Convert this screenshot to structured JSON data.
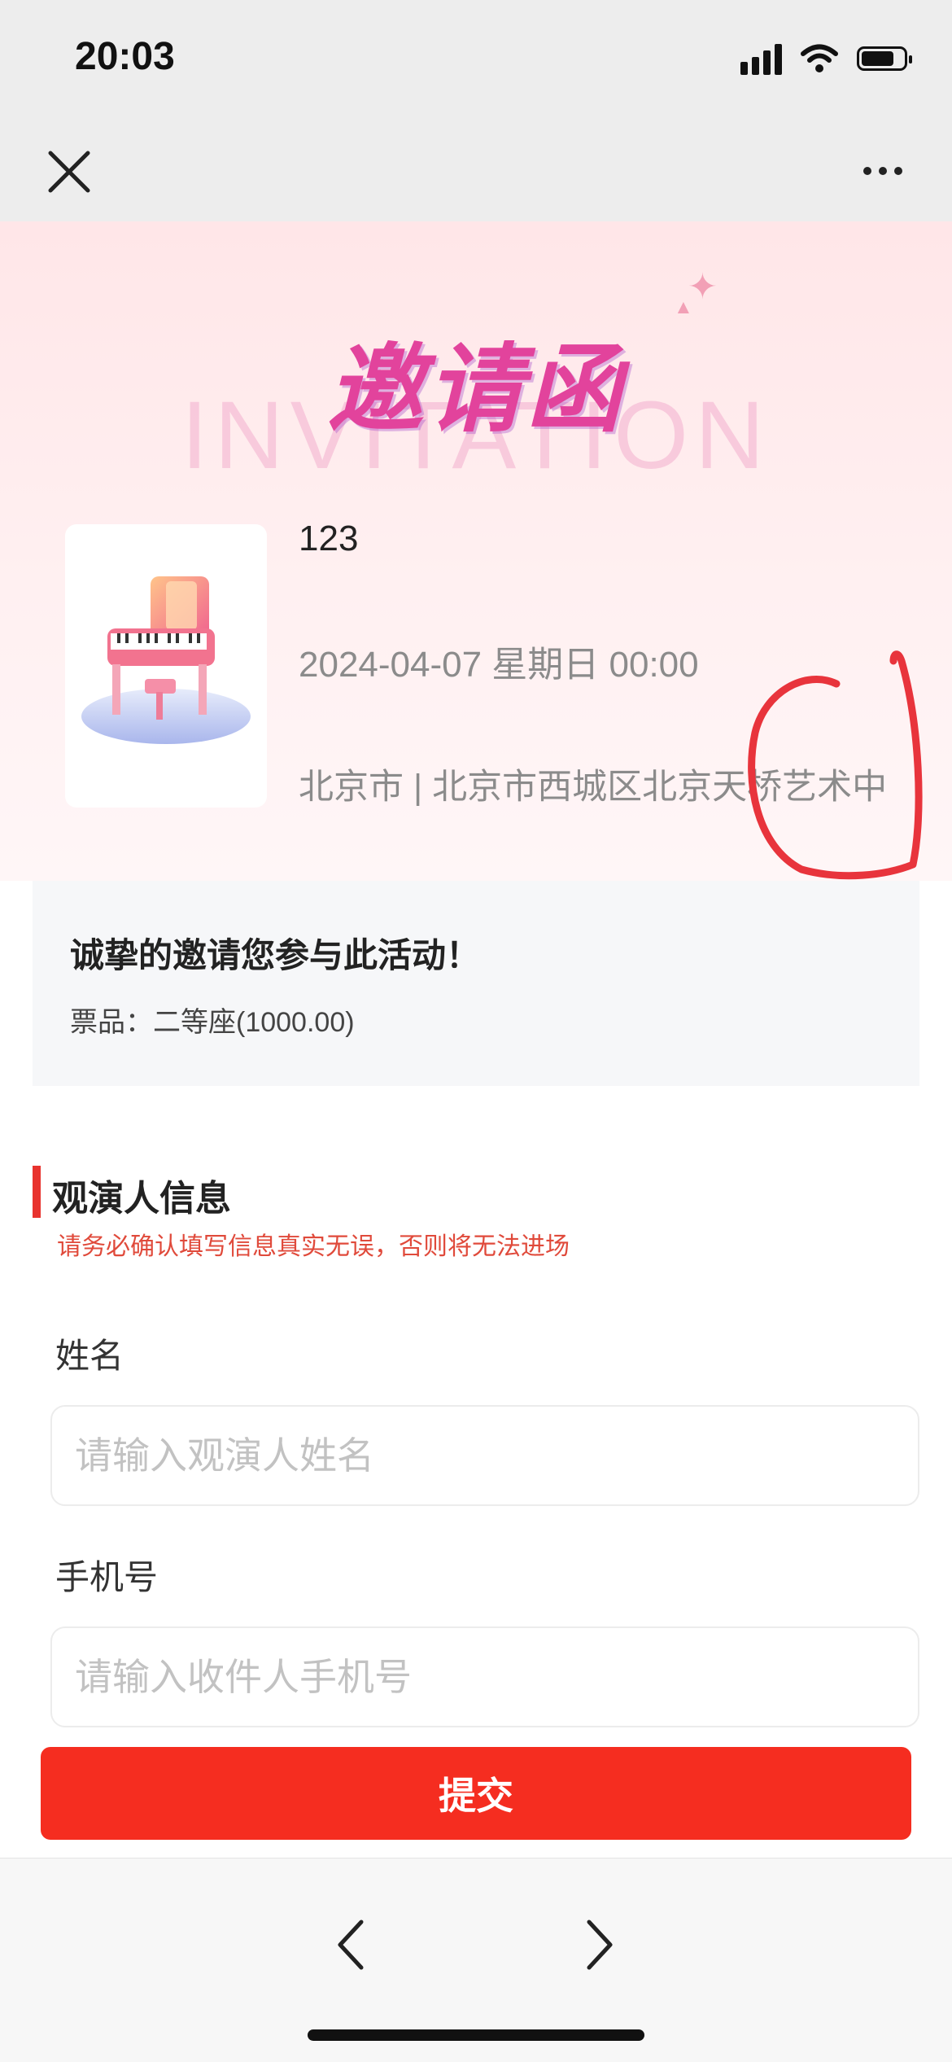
{
  "status_bar": {
    "time": "20:03",
    "battery_level": 0.78
  },
  "nav": {
    "close_icon": "close-icon",
    "more_icon": "more-dots-icon"
  },
  "hero": {
    "title": "邀请函",
    "subtitle": "INVITATION"
  },
  "event": {
    "name": "123",
    "datetime": "2024-04-07 星期日 00:00",
    "location": "北京市 | 北京市西城区北京天桥艺术中心",
    "image_icon": "piano-icon"
  },
  "invitation": {
    "message": "诚挚的邀请您参与此活动！",
    "ticket": "票品：二等座(1000.00)"
  },
  "audience_section": {
    "title": "观演人信息",
    "warning": "请务必确认填写信息真实无误，否则将无法进场"
  },
  "form": {
    "name_label": "姓名",
    "name_placeholder": "请输入观演人姓名",
    "phone_label": "手机号",
    "phone_placeholder": "请输入收件人手机号",
    "submit_label": "提交"
  },
  "toolbar": {
    "back_icon": "chevron-left-icon",
    "forward_icon": "chevron-right-icon"
  },
  "colors": {
    "accent": "#f52d20",
    "title_pink": "#e2439c",
    "warning": "#e04a3b"
  }
}
